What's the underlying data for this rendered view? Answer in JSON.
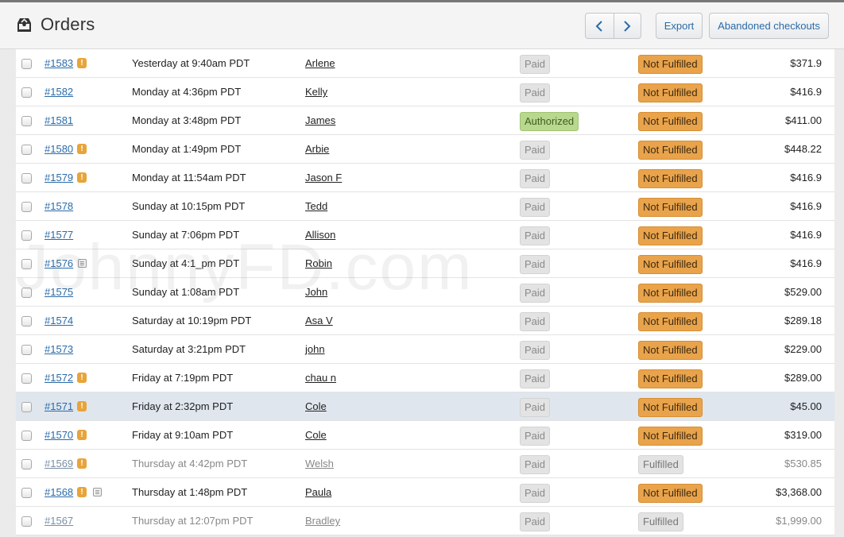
{
  "header": {
    "title": "Orders",
    "title_icon": "inbox-tray-icon",
    "prev_icon": "chevron-left-icon",
    "next_icon": "chevron-right-icon",
    "export_label": "Export",
    "abandoned_label": "Abandoned checkouts"
  },
  "colors": {
    "link": "#2a6ba8",
    "warning": "#e8a43a",
    "not_fulfilled": "#e9a34b",
    "authorized": "#b8d88f",
    "paid": "#e3e3e3"
  },
  "watermark": "JohnnyFD.com",
  "orders": [
    {
      "number": "#1583",
      "flag": true,
      "note": false,
      "date": "Yesterday at 9:40am PDT",
      "customer": "Arlene",
      "payment": "Paid",
      "fulfillment": "Not Fulfilled",
      "total": "$371.9"
    },
    {
      "number": "#1582",
      "flag": false,
      "note": false,
      "date": "Monday at 4:36pm PDT",
      "customer": "Kelly",
      "payment": "Paid",
      "fulfillment": "Not Fulfilled",
      "total": "$416.9"
    },
    {
      "number": "#1581",
      "flag": false,
      "note": false,
      "date": "Monday at 3:48pm PDT",
      "customer": "James",
      "payment": "Authorized",
      "fulfillment": "Not Fulfilled",
      "total": "$411.00"
    },
    {
      "number": "#1580",
      "flag": true,
      "note": false,
      "date": "Monday at 1:49pm PDT",
      "customer": "Arbie",
      "payment": "Paid",
      "fulfillment": "Not Fulfilled",
      "total": "$448.22"
    },
    {
      "number": "#1579",
      "flag": true,
      "note": false,
      "date": "Monday at 11:54am PDT",
      "customer": "Jason F",
      "payment": "Paid",
      "fulfillment": "Not Fulfilled",
      "total": "$416.9"
    },
    {
      "number": "#1578",
      "flag": false,
      "note": false,
      "date": "Sunday at 10:15pm PDT",
      "customer": "Tedd",
      "payment": "Paid",
      "fulfillment": "Not Fulfilled",
      "total": "$416.9"
    },
    {
      "number": "#1577",
      "flag": false,
      "note": false,
      "date": "Sunday at 7:06pm PDT",
      "customer": "Allison",
      "payment": "Paid",
      "fulfillment": "Not Fulfilled",
      "total": "$416.9"
    },
    {
      "number": "#1576",
      "flag": false,
      "note": true,
      "date": "Sunday at 4:1_pm PDT",
      "customer": "Robin",
      "payment": "Paid",
      "fulfillment": "Not Fulfilled",
      "total": "$416.9"
    },
    {
      "number": "#1575",
      "flag": false,
      "note": false,
      "date": "Sunday at 1:08am PDT",
      "customer": "John",
      "payment": "Paid",
      "fulfillment": "Not Fulfilled",
      "total": "$529.00"
    },
    {
      "number": "#1574",
      "flag": false,
      "note": false,
      "date": "Saturday at 10:19pm PDT",
      "customer": "Asa V",
      "payment": "Paid",
      "fulfillment": "Not Fulfilled",
      "total": "$289.18"
    },
    {
      "number": "#1573",
      "flag": false,
      "note": false,
      "date": "Saturday at 3:21pm PDT",
      "customer": "john",
      "payment": "Paid",
      "fulfillment": "Not Fulfilled",
      "total": "$229.00"
    },
    {
      "number": "#1572",
      "flag": true,
      "note": false,
      "date": "Friday at 7:19pm PDT",
      "customer": "chau n",
      "payment": "Paid",
      "fulfillment": "Not Fulfilled",
      "total": "$289.00"
    },
    {
      "number": "#1571",
      "flag": true,
      "note": false,
      "date": "Friday at 2:32pm PDT",
      "customer": "Cole",
      "payment": "Paid",
      "fulfillment": "Not Fulfilled",
      "total": "$45.00",
      "selected": true
    },
    {
      "number": "#1570",
      "flag": true,
      "note": false,
      "date": "Friday at 9:10am PDT",
      "customer": "Cole",
      "payment": "Paid",
      "fulfillment": "Not Fulfilled",
      "total": "$319.00"
    },
    {
      "number": "#1569",
      "flag": true,
      "note": false,
      "date": "Thursday at 4:42pm PDT",
      "customer": "Welsh",
      "payment": "Paid",
      "fulfillment": "Fulfilled",
      "total": "$530.85",
      "muted": true
    },
    {
      "number": "#1568",
      "flag": true,
      "note": true,
      "date": "Thursday at 1:48pm PDT",
      "customer": "Paula",
      "payment": "Paid",
      "fulfillment": "Not Fulfilled",
      "total": "$3,368.00"
    },
    {
      "number": "#1567",
      "flag": false,
      "note": false,
      "date": "Thursday at 12:07pm PDT",
      "customer": "Bradley",
      "payment": "Paid",
      "fulfillment": "Fulfilled",
      "total": "$1,999.00",
      "muted": true
    }
  ]
}
